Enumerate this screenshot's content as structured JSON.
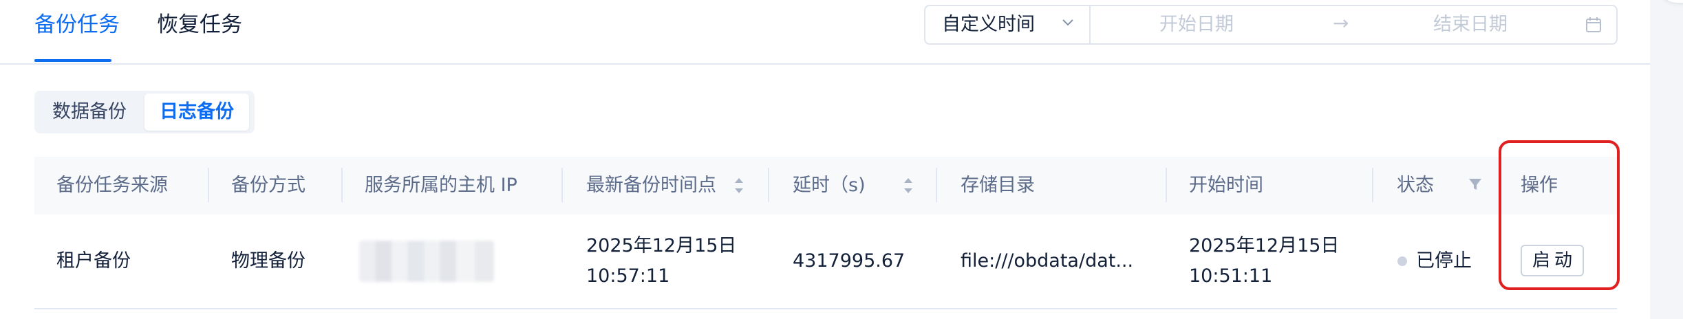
{
  "tabs": [
    {
      "label": "备份任务",
      "active": true
    },
    {
      "label": "恢复任务",
      "active": false
    }
  ],
  "date_range": {
    "mode": "自定义时间",
    "start_placeholder": "开始日期",
    "end_placeholder": "结束日期",
    "arrow": "→"
  },
  "segmented": [
    {
      "label": "数据备份",
      "active": false
    },
    {
      "label": "日志备份",
      "active": true
    }
  ],
  "table": {
    "columns": [
      {
        "label": "备份任务来源"
      },
      {
        "label": "备份方式"
      },
      {
        "label": "服务所属的主机 IP"
      },
      {
        "label": "最新备份时间点",
        "sortable": true
      },
      {
        "label": "延时（s)",
        "sortable": true
      },
      {
        "label": "存储目录"
      },
      {
        "label": "开始时间"
      },
      {
        "label": "状态",
        "filterable": true
      },
      {
        "label": "操作"
      }
    ],
    "rows": [
      {
        "source": "租户备份",
        "method": "物理备份",
        "host_ip": "",
        "latest_point_date": "2025年12月15日",
        "latest_point_time": "10:57:11",
        "delay": "4317995.67",
        "storage": "file:///obdata/dat...",
        "start_date": "2025年12月15日",
        "start_time": "10:51:11",
        "status": "已停止",
        "action": "启动"
      }
    ]
  },
  "colors": {
    "primary": "#0d6cf2",
    "highlight": "#e02020",
    "status_stopped": "#cdd4e0"
  }
}
